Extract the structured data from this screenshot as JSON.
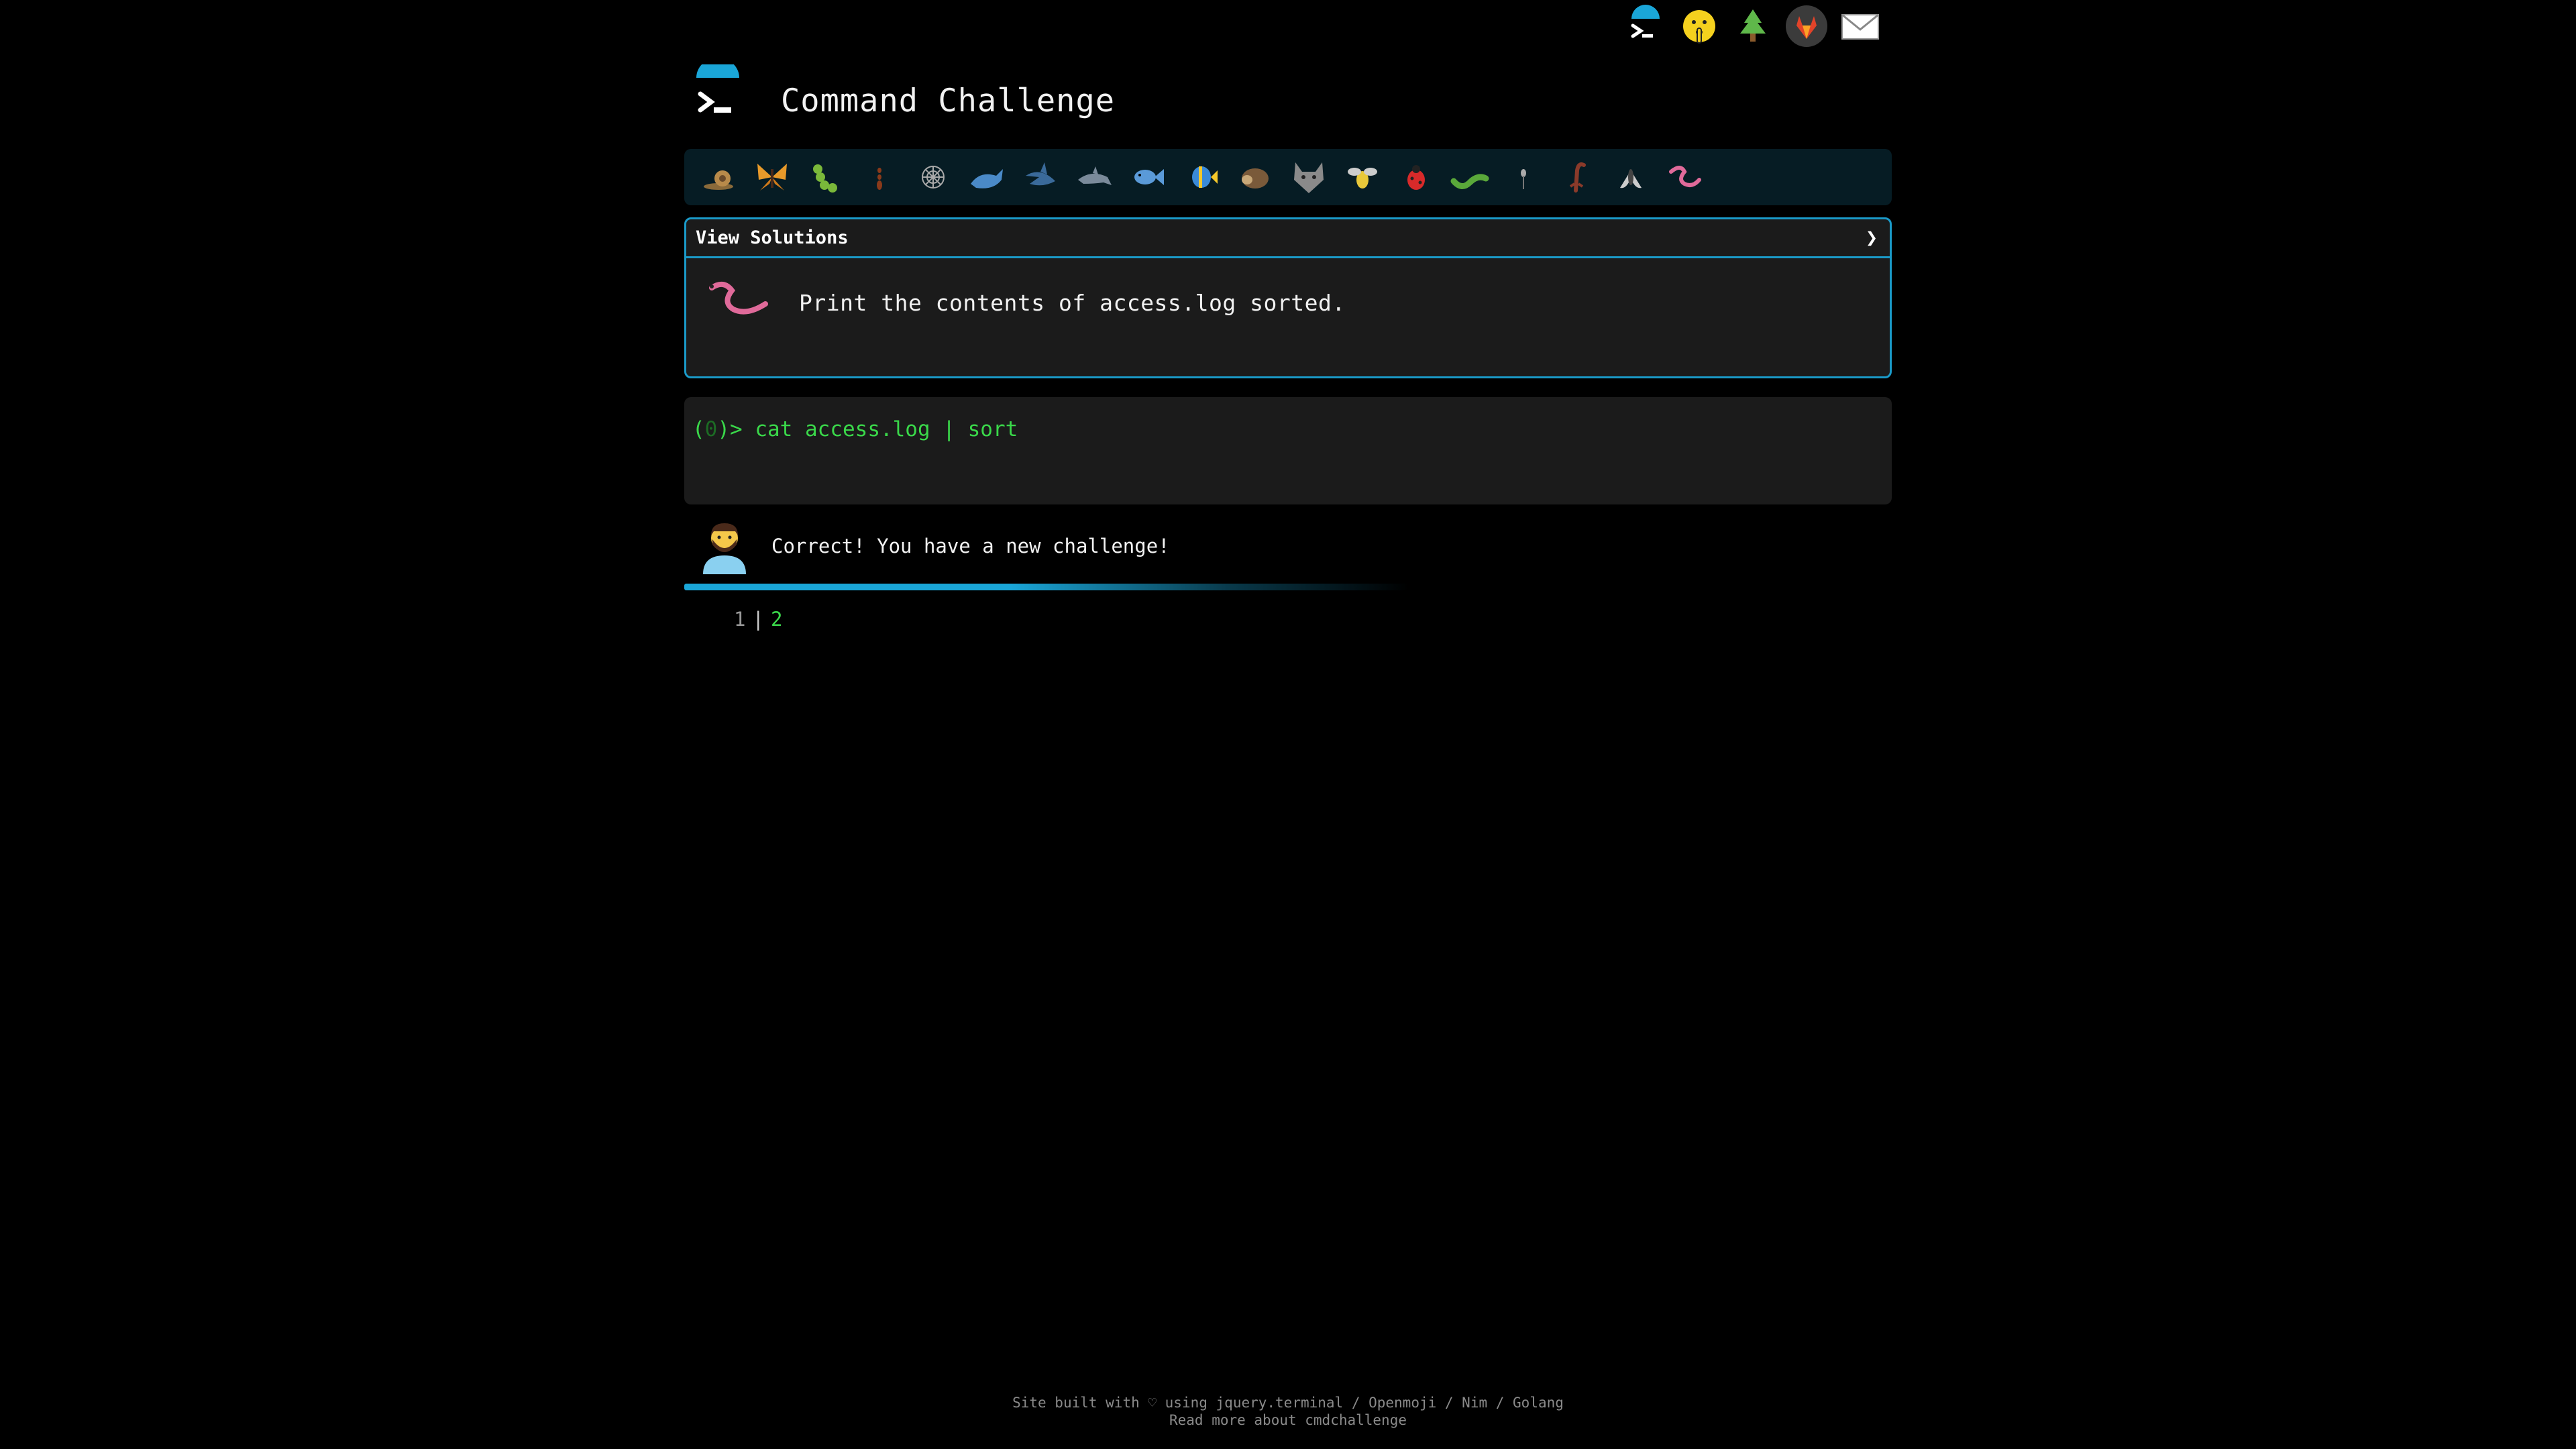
{
  "header": {
    "title": "Command Challenge"
  },
  "topnav": {
    "icons": [
      "terminal-logo-icon",
      "shushing-face-icon",
      "evergreen-tree-icon",
      "gitlab-icon",
      "envelope-icon"
    ]
  },
  "challenges": {
    "icons": [
      "snail-icon",
      "butterfly-icon",
      "caterpillar-icon",
      "ant-icon",
      "spider-web-icon",
      "whale-icon",
      "shark-icon",
      "dolphin-icon",
      "fish-icon",
      "tropical-fish-icon",
      "hedgehog-icon",
      "wolf-icon",
      "bee-icon",
      "ladybug-icon",
      "worm-green-icon",
      "mosquito-icon",
      "scorpion-icon",
      "fly-icon",
      "worm-icon"
    ]
  },
  "panel": {
    "solutions_label": "View Solutions",
    "chevron": "❯",
    "task": "Print the contents of access.log sorted."
  },
  "terminal": {
    "prompt_open": "(",
    "prompt_status": "0",
    "prompt_close": ")> ",
    "command": "cat access.log | sort"
  },
  "result": {
    "message": "Correct! You have a new challenge!",
    "progress": 0.5
  },
  "pager": {
    "done": "1",
    "separator": "|",
    "current": "2"
  },
  "footer": {
    "line1": "Site built with ♡ using jquery.terminal / Openmoji / Nim / Golang",
    "line2": "Read more about cmdchallenge"
  },
  "colors": {
    "accent": "#1a9ac8",
    "prompt_green": "#3ad84a",
    "bar_bg": "#061c24"
  }
}
